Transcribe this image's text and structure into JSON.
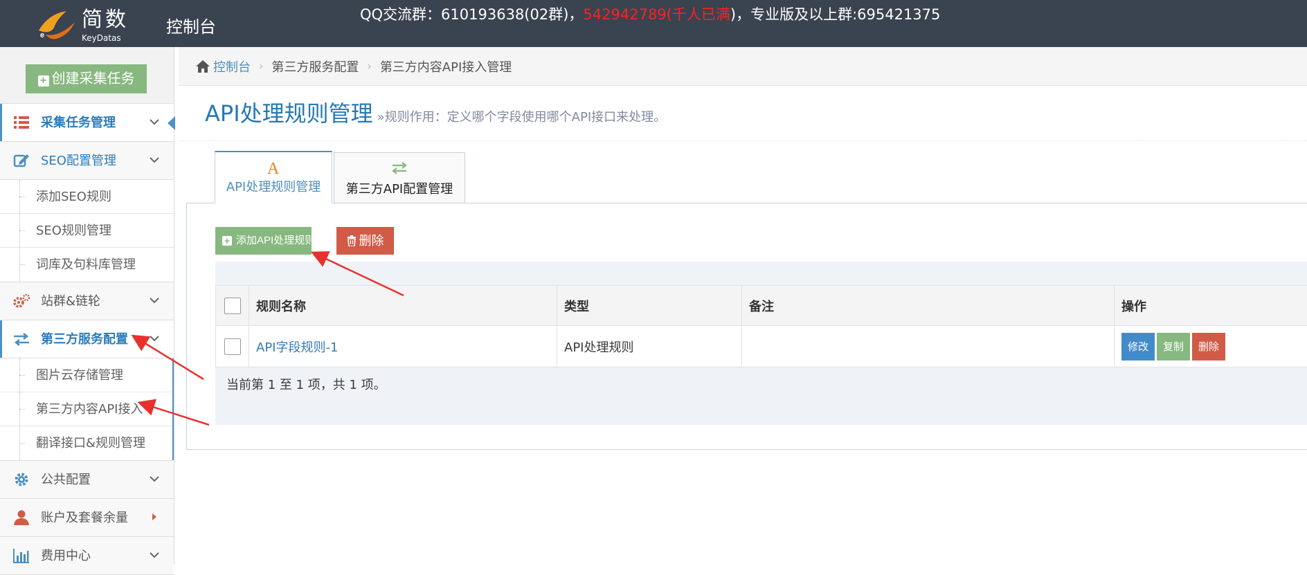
{
  "topbar": {
    "logo_name": "简数",
    "logo_sub": "KeyDatas",
    "console_title": "控制台",
    "notice_prefix": "QQ交流群：610193638(02群)，",
    "notice_red": "542942789(千人已满",
    "notice_suffix": ")，专业版及以上群:695421375"
  },
  "sidebar": {
    "create_label": "创建采集任务",
    "items": [
      {
        "label": "采集任务管理",
        "icon": "list-icon"
      },
      {
        "label": "SEO配置管理",
        "icon": "edit-icon"
      },
      {
        "label": "站群&链轮",
        "icon": "cogs-icon"
      },
      {
        "label": "第三方服务配置",
        "icon": "exchange-icon"
      },
      {
        "label": "公共配置",
        "icon": "gear-icon"
      },
      {
        "label": "账户及套餐余量",
        "icon": "user-icon"
      },
      {
        "label": "费用中心",
        "icon": "bar-chart-icon"
      }
    ],
    "seo_sub": [
      "添加SEO规则",
      "SEO规则管理",
      "词库及句料库管理"
    ],
    "thirdparty_sub": [
      "图片云存储管理",
      "第三方内容API接入",
      "翻译接口&规则管理"
    ]
  },
  "breadcrumb": {
    "home": "控制台",
    "level2": "第三方服务配置",
    "level3": "第三方内容API接入管理"
  },
  "page": {
    "title": "API处理规则管理",
    "subtitle": "»规则作用：定义哪个字段使用哪个API接口来处理。"
  },
  "tabs": [
    {
      "label": "API处理规则管理",
      "icon": "font-a-icon"
    },
    {
      "label": "第三方API配置管理",
      "icon": "exchange-icon"
    }
  ],
  "toolbar": {
    "add_label": "添加API处理规则",
    "delete_label": "删除"
  },
  "table": {
    "headers": [
      "规则名称",
      "类型",
      "备注",
      "操作"
    ],
    "rows": [
      {
        "name": "API字段规则-1",
        "type": "API处理规则",
        "note": "",
        "actions": [
          "修改",
          "复制",
          "删除"
        ]
      }
    ],
    "pager_text": "当前第 1 至 1 项，共 1 项。"
  },
  "colors": {
    "topbar": "#3a4350",
    "accent_blue": "#2679b5",
    "green": "#87b87f",
    "red": "#d15b47",
    "annotation_arrow": "#e8312f"
  }
}
